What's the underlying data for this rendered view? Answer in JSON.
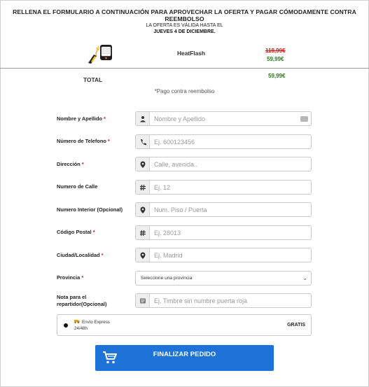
{
  "header": {
    "title": "RELLENA EL FORMULARIO A CONTINUACIÓN PARA APROVECHAR LA OFERTA Y PAGAR CÓMODAMENTE CONTRA REEMBOLSO",
    "valid_line": "LA OFERTA ES VÁLIDA HASTA EL",
    "valid_date": "JUEVES 4 DE DICIEMBRE."
  },
  "product": {
    "name": "HeatFlash",
    "old_price": "119,99€",
    "new_price": "59,99€",
    "image_icon": "heater-product-icon"
  },
  "summary": {
    "total_label": "TOTAL",
    "total_value": "59,99€",
    "payment_note": "*Pago contra reembolso"
  },
  "form": {
    "fields": [
      {
        "label": "Nombre y Apellido",
        "required": "*",
        "placeholder": "Nombre y Apellido",
        "icon": "person-icon"
      },
      {
        "label": "Número de Telefono",
        "required": "*",
        "placeholder": "Ej. 600123456",
        "icon": "phone-icon"
      },
      {
        "label": "Dirección",
        "required": "*",
        "placeholder": "Calle, avenida..",
        "icon": "location-pin-icon"
      },
      {
        "label": "Numero de Calle",
        "required": "",
        "placeholder": "Ej. 12",
        "icon": "hash-icon"
      },
      {
        "label": "Numero Interior (Opcional)",
        "required": "",
        "placeholder": "Num. Piso / Puerta",
        "icon": "location-pin-icon"
      },
      {
        "label": "Código Postal",
        "required": "*",
        "placeholder": "Ej. 28013",
        "icon": "hash-icon"
      },
      {
        "label": "Ciudad/Localidad",
        "required": "*",
        "placeholder": "Ej. Madrid",
        "icon": "location-pin-icon"
      }
    ],
    "province": {
      "label": "Provincia",
      "required": "*",
      "selected": "Seleccione una provincia"
    },
    "note": {
      "label_line1": "Nota para el",
      "label_line2": "repartidor(Opcional)",
      "placeholder": "Ej. Timbre sin numbre puerta roja",
      "icon": "note-icon"
    }
  },
  "shipping": {
    "name": "Envío Express",
    "time": "24/48h",
    "price": "GRATIS",
    "icon": "truck-icon"
  },
  "submit": {
    "label": "FINALIZAR PEDIDO",
    "icon": "cart-icon",
    "color": "#1e73d8"
  },
  "colors": {
    "old_price": "#dd1111",
    "new_price": "#2e7d1e",
    "required": "#dd1111"
  }
}
